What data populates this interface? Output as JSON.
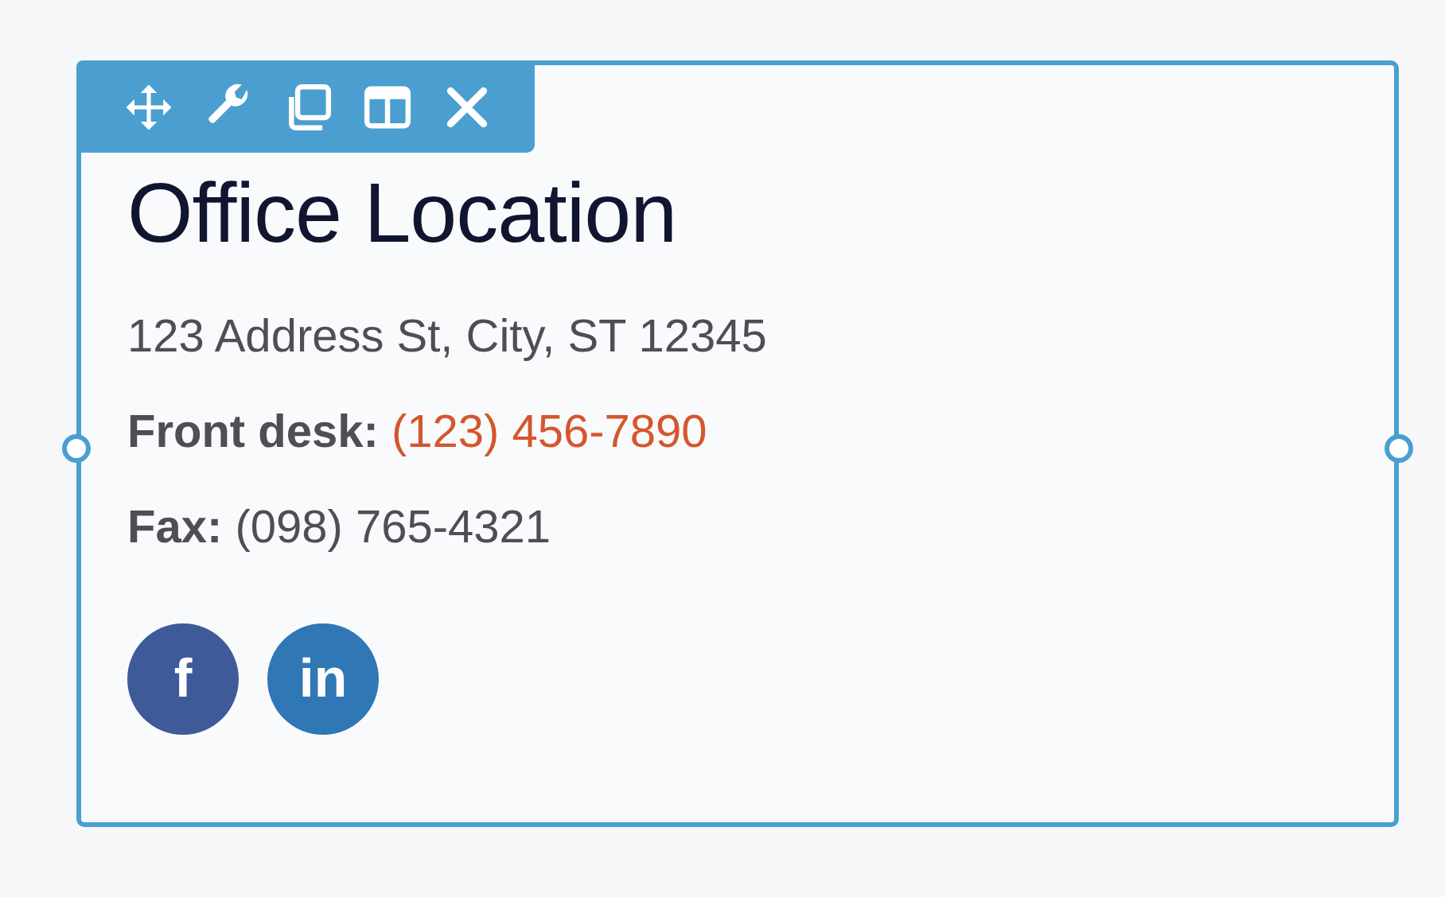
{
  "toolbar": [
    {
      "kind": "move"
    },
    {
      "kind": "settings"
    },
    {
      "kind": "duplicate"
    },
    {
      "kind": "columns"
    },
    {
      "kind": "close"
    }
  ],
  "title": "Office Location",
  "address": "123 Address St, City, ST 12345",
  "contacts": [
    {
      "label": "Front desk:",
      "value": "(123) 456-7890",
      "kind": "link"
    },
    {
      "label": "Fax:",
      "value": "(098) 765-4321",
      "kind": "text"
    }
  ],
  "social": [
    {
      "kind": "facebook",
      "glyph": "f"
    },
    {
      "kind": "linkedin",
      "glyph": "in"
    }
  ]
}
